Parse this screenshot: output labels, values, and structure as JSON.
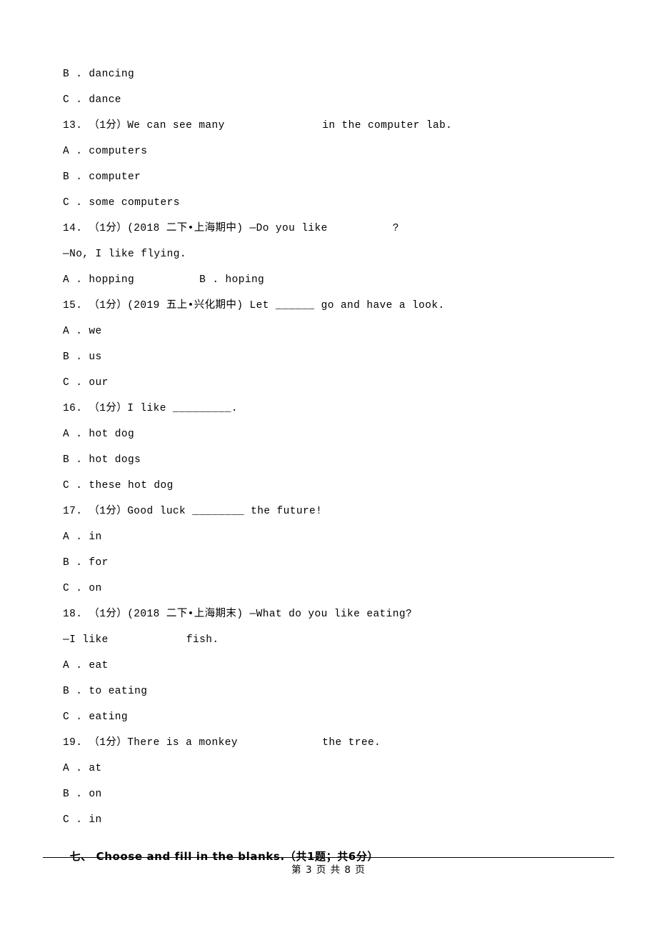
{
  "document": {
    "lines": [
      {
        "id": "l1",
        "text": "B . dancing",
        "type": "option"
      },
      {
        "id": "l2",
        "text": "C . dance",
        "type": "option"
      },
      {
        "id": "l3",
        "text": "13. （1分）We can see many               in the computer lab.",
        "type": "question"
      },
      {
        "id": "l4",
        "text": "A . computers",
        "type": "option"
      },
      {
        "id": "l5",
        "text": "B . computer",
        "type": "option"
      },
      {
        "id": "l6",
        "text": "C . some computers",
        "type": "option"
      },
      {
        "id": "l7",
        "text": "14. （1分）(2018 二下•上海期中) —Do you like          ?",
        "type": "question"
      },
      {
        "id": "l8",
        "text": "—No, I like flying.",
        "type": "continuation"
      },
      {
        "id": "l9",
        "text": "A . hopping          B . hoping",
        "type": "option"
      },
      {
        "id": "l10",
        "text": "15. （1分）(2019 五上•兴化期中) Let ______ go and have a look.",
        "type": "question"
      },
      {
        "id": "l11",
        "text": "A . we",
        "type": "option"
      },
      {
        "id": "l12",
        "text": "B . us",
        "type": "option"
      },
      {
        "id": "l13",
        "text": "C . our",
        "type": "option"
      },
      {
        "id": "l14",
        "text": "16. （1分）I like _________.",
        "type": "question"
      },
      {
        "id": "l15",
        "text": "A . hot dog",
        "type": "option"
      },
      {
        "id": "l16",
        "text": "B . hot dogs",
        "type": "option"
      },
      {
        "id": "l17",
        "text": "C . these hot dog",
        "type": "option"
      },
      {
        "id": "l18",
        "text": "17. （1分）Good luck ________ the future!",
        "type": "question"
      },
      {
        "id": "l19",
        "text": "A . in",
        "type": "option"
      },
      {
        "id": "l20",
        "text": "B . for",
        "type": "option"
      },
      {
        "id": "l21",
        "text": "C . on",
        "type": "option"
      },
      {
        "id": "l22",
        "text": "18. （1分）(2018 二下•上海期末) —What do you like eating?",
        "type": "question"
      },
      {
        "id": "l23",
        "text": "—I like            fish.",
        "type": "continuation"
      },
      {
        "id": "l24",
        "text": "A . eat",
        "type": "option"
      },
      {
        "id": "l25",
        "text": "B . to eating",
        "type": "option"
      },
      {
        "id": "l26",
        "text": "C . eating",
        "type": "option"
      },
      {
        "id": "l27",
        "text": "19. （1分）There is a monkey             the tree.",
        "type": "question"
      },
      {
        "id": "l28",
        "text": "A . at",
        "type": "option"
      },
      {
        "id": "l29",
        "text": "B . on",
        "type": "option"
      },
      {
        "id": "l30",
        "text": "C . in",
        "type": "option"
      }
    ],
    "section_heading": "七、 Choose and fill in the blanks.（共1题；共6分）",
    "footer": "第 3 页 共 8 页"
  }
}
